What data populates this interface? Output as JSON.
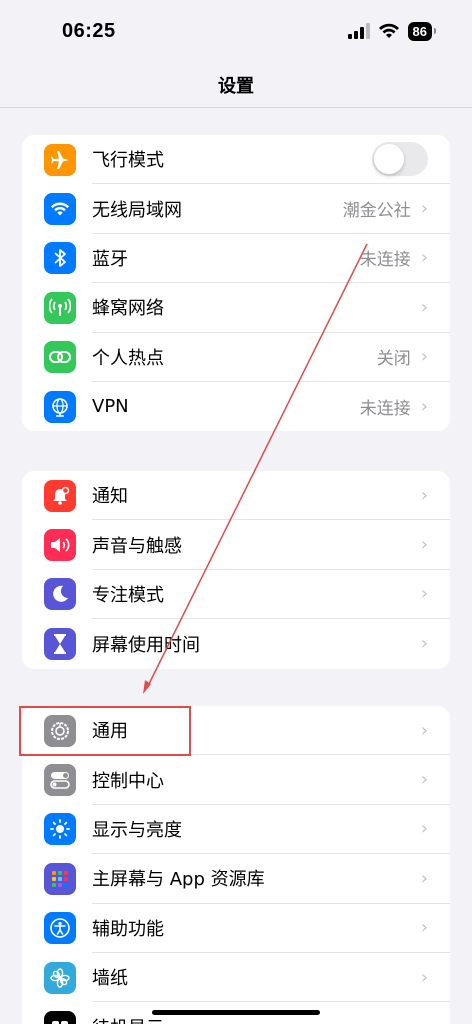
{
  "status_bar": {
    "time": "06:25",
    "battery": "86"
  },
  "nav": {
    "title": "设置"
  },
  "group1": [
    {
      "label": "飞行模式",
      "icon": "airplane-icon",
      "color": "#ff9500",
      "toggle": "off"
    },
    {
      "label": "无线局域网",
      "icon": "wifi-icon",
      "color": "#007aff",
      "value": "潮金公社"
    },
    {
      "label": "蓝牙",
      "icon": "bluetooth-icon",
      "color": "#007aff",
      "value": "未连接"
    },
    {
      "label": "蜂窝网络",
      "icon": "cellular-icon",
      "color": "#34c759",
      "value": ""
    },
    {
      "label": "个人热点",
      "icon": "hotspot-icon",
      "color": "#34c759",
      "value": "关闭"
    },
    {
      "label": "VPN",
      "icon": "vpn-globe-icon",
      "color": "#007aff",
      "value": "未连接"
    }
  ],
  "group2": [
    {
      "label": "通知",
      "icon": "notification-bell-icon",
      "color": "#ff3b30"
    },
    {
      "label": "声音与触感",
      "icon": "speaker-icon",
      "color": "#ff2d55"
    },
    {
      "label": "专注模式",
      "icon": "moon-icon",
      "color": "#5856d6"
    },
    {
      "label": "屏幕使用时间",
      "icon": "hourglass-icon",
      "color": "#5856d6"
    }
  ],
  "group3": [
    {
      "label": "通用",
      "icon": "gear-icon",
      "color": "#8e8e93"
    },
    {
      "label": "控制中心",
      "icon": "control-toggles-icon",
      "color": "#8e8e93"
    },
    {
      "label": "显示与亮度",
      "icon": "sun-icon",
      "color": "#007aff"
    },
    {
      "label": "主屏幕与 App 资源库",
      "icon": "app-grid-icon",
      "color": "#5856d6"
    },
    {
      "label": "辅助功能",
      "icon": "accessibility-icon",
      "color": "#007aff"
    },
    {
      "label": "墙纸",
      "icon": "flower-icon",
      "color": "#34aadc"
    },
    {
      "label": "待机显示",
      "icon": "standby-icon",
      "color": "#000000"
    }
  ]
}
